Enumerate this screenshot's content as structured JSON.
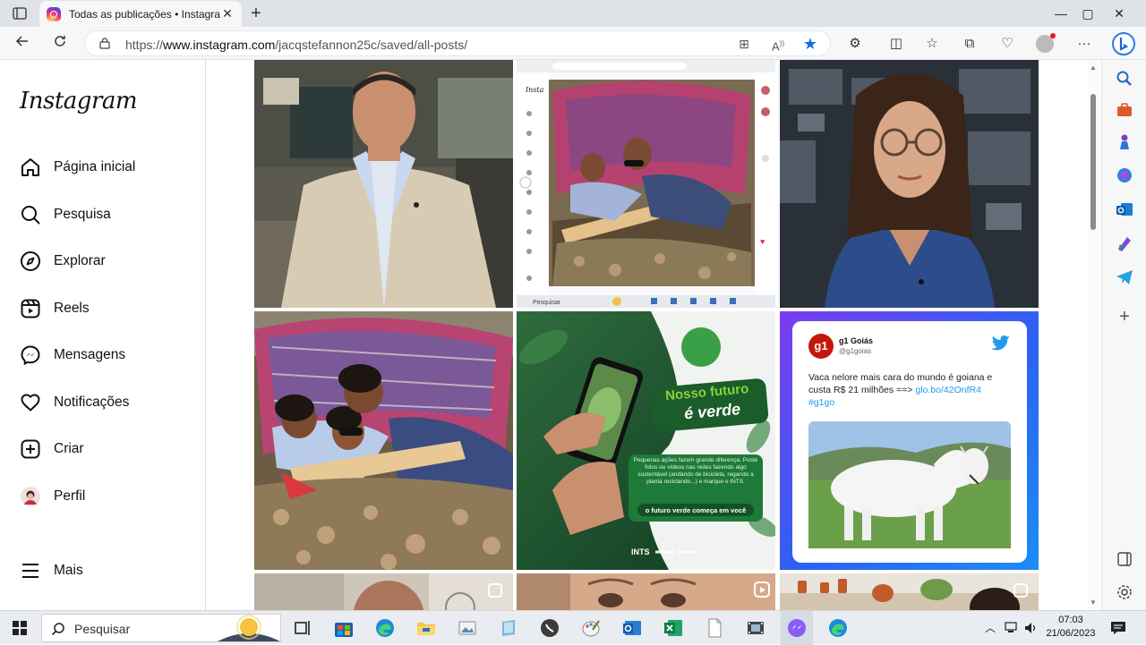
{
  "browser": {
    "tab": {
      "title": "Todas as publicações • Instagram",
      "close": "✕"
    },
    "new_tab": "+",
    "window_controls": {
      "minimize": "—",
      "maximize": "▢",
      "close": "✕"
    },
    "url_prefix": "https://",
    "url_host": "www.instagram.com",
    "url_path": "/jacqstefannon25c/saved/all-posts/"
  },
  "instagram": {
    "logo": "Instagram",
    "nav": [
      {
        "label": "Página inicial",
        "icon": "home-icon"
      },
      {
        "label": "Pesquisa",
        "icon": "search-icon"
      },
      {
        "label": "Explorar",
        "icon": "compass-icon"
      },
      {
        "label": "Reels",
        "icon": "reels-icon"
      },
      {
        "label": "Mensagens",
        "icon": "messenger-icon"
      },
      {
        "label": "Notificações",
        "icon": "heart-icon"
      },
      {
        "label": "Criar",
        "icon": "plus-square-icon"
      },
      {
        "label": "Perfil",
        "icon": "avatar"
      }
    ],
    "more": "Mais"
  },
  "posts": {
    "screenshot_taskbar_search": "Pesquisar",
    "green_post": {
      "headline_1": "Nosso futuro",
      "headline_2": "é verde",
      "body": "Pequenas ações fazem grande diferença. Poste fotos ou vídeos nas redes fazendo algo sustentável (andando de bicicleta, regando a planta reciclando...) e marque o INTS.",
      "tagline": "o futuro verde começa em você",
      "brand": "INTS"
    },
    "g1_post": {
      "badge": "g1",
      "name": "g1 Goiás",
      "handle": "@g1goias",
      "text": "Vaca nelore mais cara do mundo é goiana e custa R$ 21 milhões ==> ",
      "link": "glo.bo/42OnfR4",
      "hashtag": "#g1go"
    }
  },
  "taskbar": {
    "search_label": "Pesquisar",
    "time": "07:03",
    "date": "21/06/2023"
  }
}
